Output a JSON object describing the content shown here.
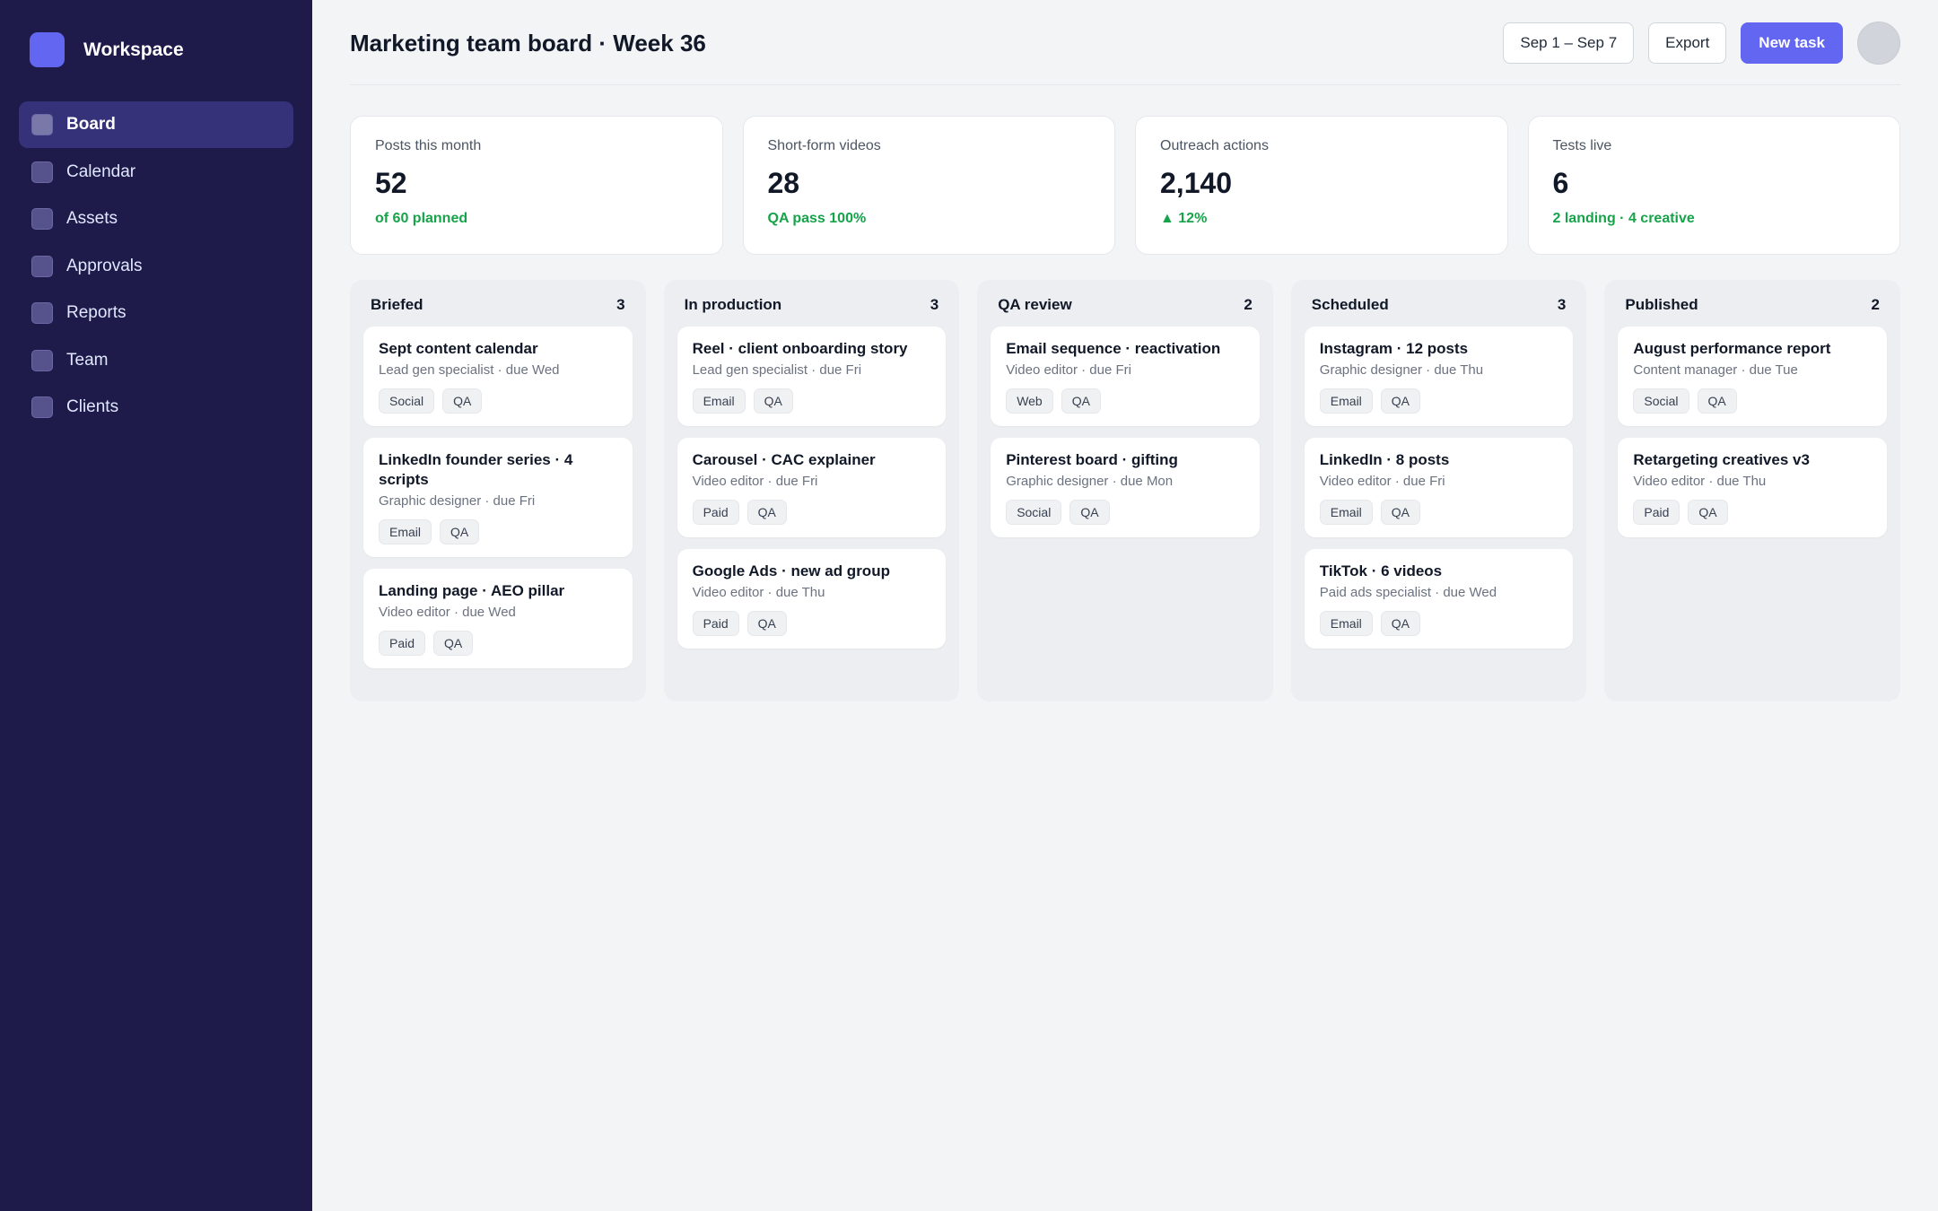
{
  "sidebar": {
    "brand": "Workspace",
    "items": [
      {
        "label": "Board"
      },
      {
        "label": "Calendar"
      },
      {
        "label": "Assets"
      },
      {
        "label": "Approvals"
      },
      {
        "label": "Reports"
      },
      {
        "label": "Team"
      },
      {
        "label": "Clients"
      }
    ],
    "active_index": 0
  },
  "header": {
    "title": "Marketing team board · Week 36",
    "date_range": "Sep 1 – Sep 7",
    "export_label": "Export",
    "new_task_label": "New task"
  },
  "stats": [
    {
      "label": "Posts this month",
      "value": "52",
      "sub": "of 60 planned"
    },
    {
      "label": "Short-form videos",
      "value": "28",
      "sub": "QA pass 100%"
    },
    {
      "label": "Outreach actions",
      "value": "2,140",
      "sub": "▲ 12%"
    },
    {
      "label": "Tests live",
      "value": "6",
      "sub": "2 landing · 4 creative"
    }
  ],
  "columns": [
    {
      "name": "Briefed",
      "count": "3",
      "cards": [
        {
          "title": "Sept content calendar",
          "meta": "Lead gen specialist · due Wed",
          "tags": [
            "Social",
            "QA"
          ]
        },
        {
          "title": "LinkedIn founder series · 4 scripts",
          "meta": "Graphic designer · due Fri",
          "tags": [
            "Email",
            "QA"
          ]
        },
        {
          "title": "Landing page · AEO pillar",
          "meta": "Video editor · due Wed",
          "tags": [
            "Paid",
            "QA"
          ]
        }
      ]
    },
    {
      "name": "In production",
      "count": "3",
      "cards": [
        {
          "title": "Reel · client onboarding story",
          "meta": "Lead gen specialist · due Fri",
          "tags": [
            "Email",
            "QA"
          ]
        },
        {
          "title": "Carousel · CAC explainer",
          "meta": "Video editor · due Fri",
          "tags": [
            "Paid",
            "QA"
          ]
        },
        {
          "title": "Google Ads · new ad group",
          "meta": "Video editor · due Thu",
          "tags": [
            "Paid",
            "QA"
          ]
        }
      ]
    },
    {
      "name": "QA review",
      "count": "2",
      "cards": [
        {
          "title": "Email sequence · reactivation",
          "meta": "Video editor · due Fri",
          "tags": [
            "Web",
            "QA"
          ]
        },
        {
          "title": "Pinterest board · gifting",
          "meta": "Graphic designer · due Mon",
          "tags": [
            "Social",
            "QA"
          ]
        }
      ]
    },
    {
      "name": "Scheduled",
      "count": "3",
      "cards": [
        {
          "title": "Instagram · 12 posts",
          "meta": "Graphic designer · due Thu",
          "tags": [
            "Email",
            "QA"
          ]
        },
        {
          "title": "LinkedIn · 8 posts",
          "meta": "Video editor · due Fri",
          "tags": [
            "Email",
            "QA"
          ]
        },
        {
          "title": "TikTok · 6 videos",
          "meta": "Paid ads specialist · due Wed",
          "tags": [
            "Email",
            "QA"
          ]
        }
      ]
    },
    {
      "name": "Published",
      "count": "2",
      "cards": [
        {
          "title": "August performance report",
          "meta": "Content manager · due Tue",
          "tags": [
            "Social",
            "QA"
          ]
        },
        {
          "title": "Retargeting creatives v3",
          "meta": "Video editor · due Thu",
          "tags": [
            "Paid",
            "QA"
          ]
        }
      ]
    }
  ],
  "colors": {
    "sidebar_bg": "#1e1b4b",
    "accent": "#6366f1",
    "positive": "#16a34a"
  }
}
